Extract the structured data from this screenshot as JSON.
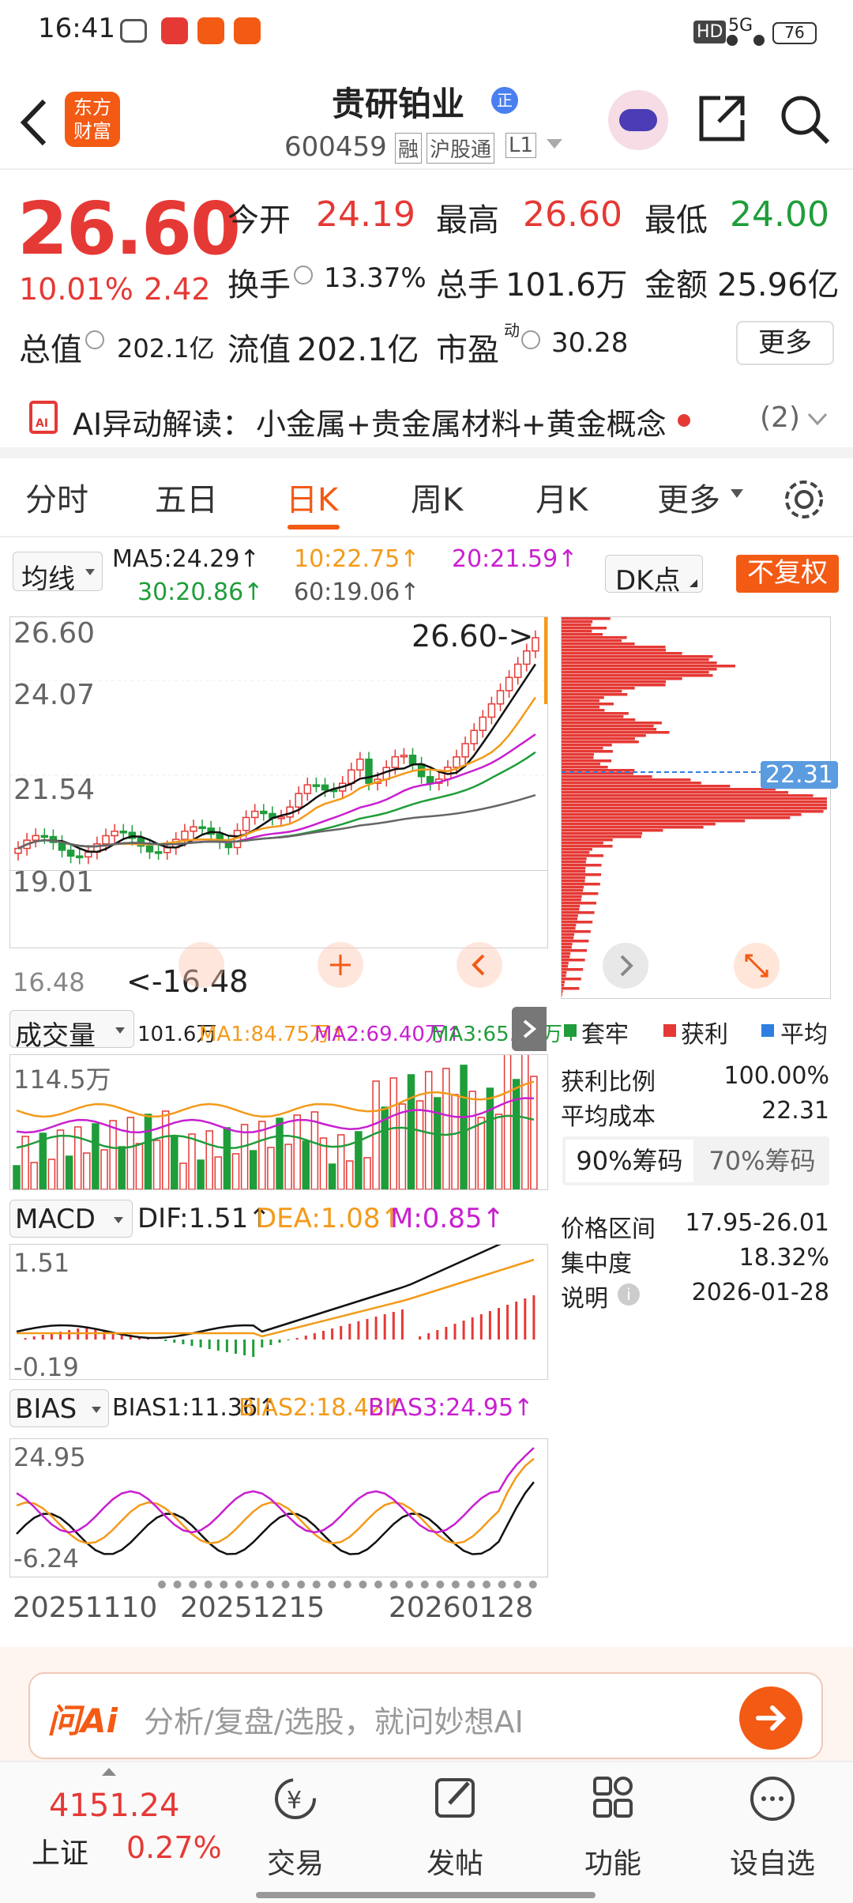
{
  "status": {
    "time": "16:41",
    "hd": "HD",
    "net": "5G",
    "battery": "76"
  },
  "header": {
    "logo_line1": "东方",
    "logo_line2": "财富",
    "title": "贵研铂业",
    "title_badge": "正",
    "code": "600459",
    "tags": [
      "融",
      "沪股通",
      "L1"
    ]
  },
  "quote": {
    "price": "26.60",
    "pct": "10.01%",
    "change": "2.42",
    "open_label": "今开",
    "open": "24.19",
    "high_label": "最高",
    "high": "26.60",
    "low_label": "最低",
    "low": "24.00",
    "turnover_label": "换手",
    "turnover": "13.37%",
    "volume_label": "总手",
    "volume": "101.6万",
    "amount_label": "金额",
    "amount": "25.96亿",
    "mktcap_label": "总值",
    "mktcap": "202.1亿",
    "float_label": "流值",
    "float": "202.1亿",
    "pe_label": "市盈",
    "pe_sup": "动",
    "pe": "30.28",
    "more": "更多"
  },
  "ai": {
    "label": "AI异动解读：",
    "text": "小金属+贵金属材料+黄金概念",
    "count": "(2)"
  },
  "tabs": [
    "分时",
    "五日",
    "日K",
    "周K",
    "月K",
    "更多"
  ],
  "active_tab": "日K",
  "kline": {
    "ma_label": "均线",
    "ma5": "MA5:24.29↑",
    "ma10": "10:22.75↑",
    "ma20": "20:21.59↑",
    "ma30": "30:20.86↑",
    "ma60": "60:19.06↑",
    "dk": "DK点",
    "fq": "不复权",
    "y_labels": [
      "26.60",
      "24.07",
      "21.54",
      "19.01",
      "16.48"
    ],
    "last_marker": "26.60->",
    "low_marker": "<-16.48"
  },
  "volume": {
    "label": "成交量",
    "v": "101.6万",
    "ma1": "MA1:84.75万↑",
    "ma2": "MA2:69.40万↑",
    "ma3": "MA3:65.36万↑",
    "axis": "114.5万"
  },
  "macd": {
    "label": "MACD",
    "dif": "DIF:1.51↑",
    "dea": "DEA:1.08↑",
    "m": "M:0.85↑",
    "top": "1.51",
    "bottom": "-0.19"
  },
  "bias": {
    "label": "BIAS",
    "b1": "BIAS1:11.36↑",
    "b2": "BIAS2:18.42↑",
    "b3": "BIAS3:24.95↑",
    "top": "24.95",
    "bottom": "-6.24"
  },
  "dates": [
    "20251110",
    "20251215",
    "20260128"
  ],
  "chips": {
    "avg": "22.31",
    "legend": [
      "套牢",
      "获利",
      "平均"
    ],
    "profit_ratio_label": "获利比例",
    "profit_ratio": "100.00%",
    "avg_cost_label": "平均成本",
    "avg_cost": "22.31",
    "tab90": "90%筹码",
    "tab70": "70%筹码",
    "range_label": "价格区间",
    "range": "17.95-26.01",
    "conc_label": "集中度",
    "conc": "18.32%",
    "note_label": "说明",
    "note": "2026-01-28"
  },
  "ask": {
    "logo": "问Ai",
    "placeholder": "分析/复盘/选股，就问妙想AI"
  },
  "nav": {
    "index_val": "4151.24",
    "index_name": "上证",
    "index_pct": "0.27%",
    "items": [
      "交易",
      "发帖",
      "功能",
      "设自选"
    ]
  },
  "colors": {
    "up": "#e53935",
    "down": "#1f9d3a",
    "accent": "#f35a14",
    "ma10": "#f39a1a",
    "ma20": "#c81fd0"
  }
}
